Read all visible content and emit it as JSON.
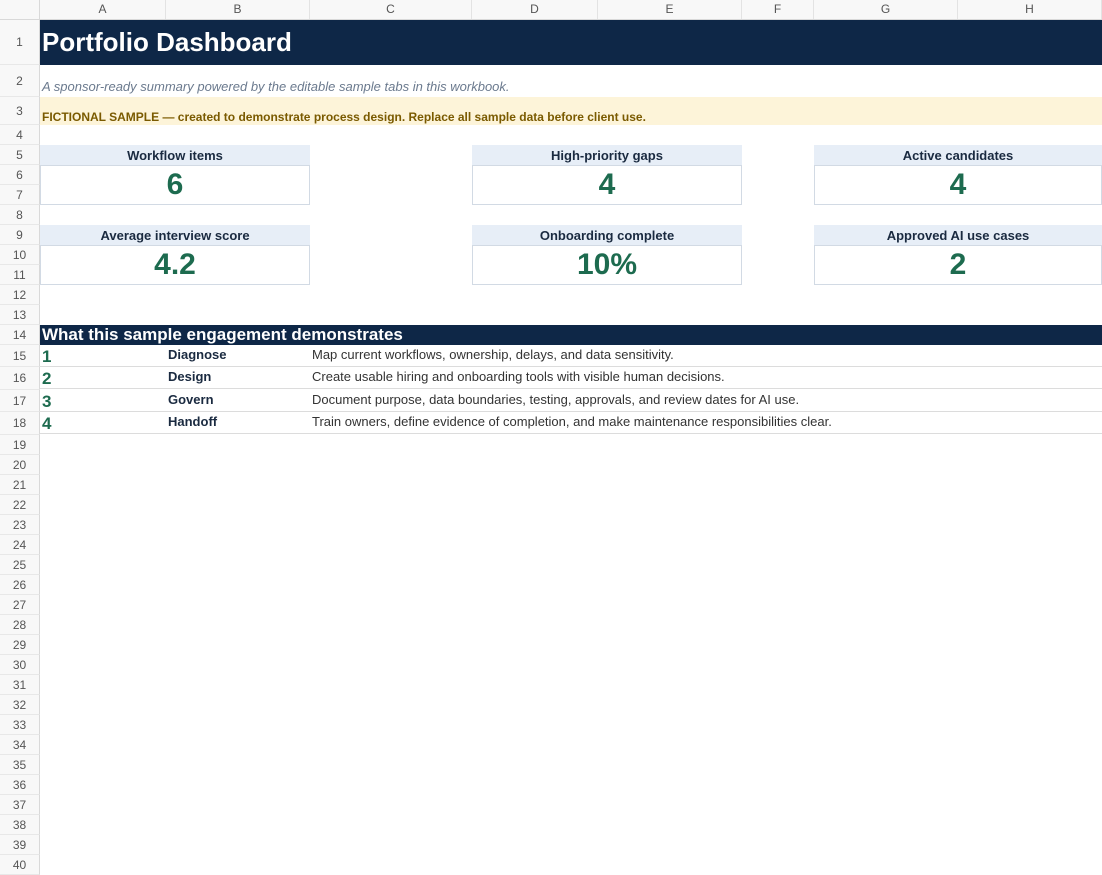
{
  "columns": [
    "A",
    "B",
    "C",
    "D",
    "E",
    "F",
    "G",
    "H"
  ],
  "rows": [
    "1",
    "2",
    "3",
    "4",
    "5",
    "6",
    "7",
    "8",
    "9",
    "10",
    "11",
    "12",
    "13",
    "14",
    "15",
    "16",
    "17",
    "18",
    "19",
    "20",
    "21",
    "22",
    "23",
    "24",
    "25",
    "26",
    "27",
    "28",
    "29",
    "30",
    "31",
    "32",
    "33",
    "34",
    "35",
    "36",
    "37",
    "38",
    "39",
    "40"
  ],
  "title": "Portfolio Dashboard",
  "subtitle": "A sponsor-ready summary powered by the editable sample tabs in this workbook.",
  "notice": "FICTIONAL SAMPLE — created to demonstrate process design. Replace all sample data before client use.",
  "kpis": [
    {
      "label": "Workflow items",
      "value": "6"
    },
    {
      "label": "High-priority gaps",
      "value": "4"
    },
    {
      "label": "Active candidates",
      "value": "4"
    },
    {
      "label": "Average interview score",
      "value": "4.2"
    },
    {
      "label": "Onboarding complete",
      "value": "10%"
    },
    {
      "label": "Approved AI use cases",
      "value": "2"
    }
  ],
  "section": {
    "title": "What this sample engagement demonstrates",
    "steps": [
      {
        "num": "1",
        "name": "Diagnose",
        "desc": "Map current workflows, ownership, delays, and data sensitivity."
      },
      {
        "num": "2",
        "name": "Design",
        "desc": "Create usable hiring and onboarding tools with visible human decisions."
      },
      {
        "num": "3",
        "name": "Govern",
        "desc": "Document purpose, data boundaries, testing, approvals, and review dates for AI use."
      },
      {
        "num": "4",
        "name": "Handoff",
        "desc": "Train owners, define evidence of completion, and make maintenance responsibilities clear."
      }
    ]
  },
  "colors": {
    "navy": "#0e2747",
    "green": "#1d6b4f",
    "notice_bg": "#fdf4d9",
    "kpi_label_bg": "#e7eef7"
  }
}
